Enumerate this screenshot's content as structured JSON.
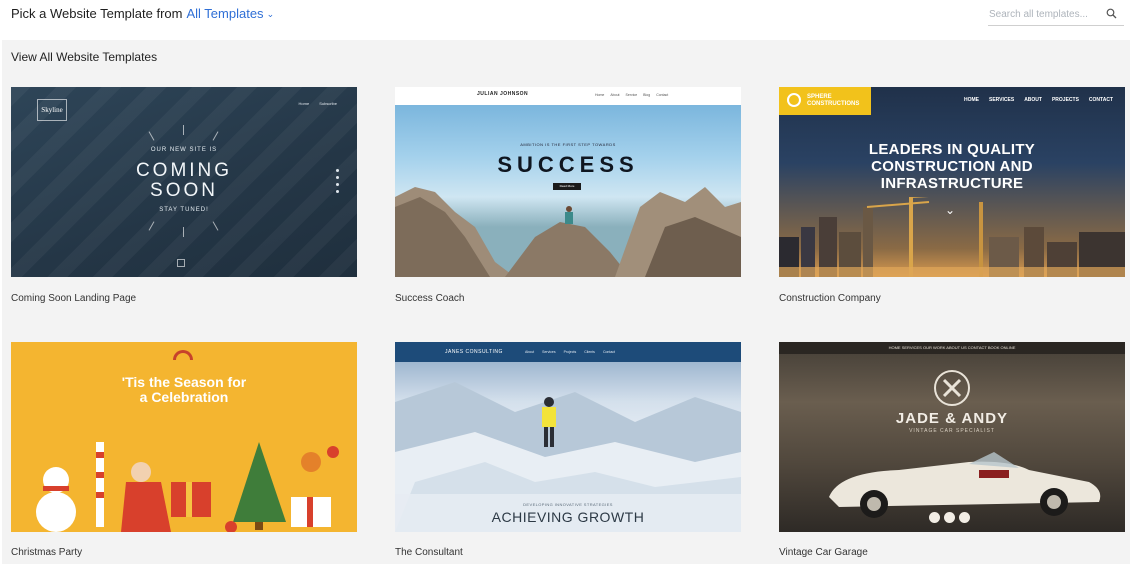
{
  "header": {
    "title_prefix": "Pick a Website Template from",
    "dropdown_label": "All Templates",
    "search_placeholder": "Search all templates..."
  },
  "gallery": {
    "heading": "View All Website Templates",
    "templates": [
      {
        "label": "Coming Soon Landing Page",
        "thumb": {
          "logo": "Skyline",
          "kicker": "OUR NEW SITE IS",
          "line1": "COMING",
          "line2": "SOON",
          "tag": "STAY TUNED!"
        }
      },
      {
        "label": "Success Coach",
        "thumb": {
          "brand": "JULIAN JOHNSON",
          "kicker": "AMBITION IS THE FIRST STEP TOWARDS",
          "headline": "SUCCESS",
          "button": "Read More"
        }
      },
      {
        "label": "Construction Company",
        "thumb": {
          "logo_line1": "SPHERE",
          "logo_line2": "CONSTRUCTIONS",
          "nav": [
            "HOME",
            "SERVICES",
            "ABOUT",
            "PROJECTS",
            "CONTACT"
          ],
          "line1": "LEADERS IN QUALITY",
          "line2": "CONSTRUCTION AND",
          "line3": "INFRASTRUCTURE"
        }
      },
      {
        "label": "Christmas Party",
        "thumb": {
          "line1": "'Tis the Season for",
          "line2": "a Celebration"
        }
      },
      {
        "label": "The Consultant",
        "thumb": {
          "brand": "JANES CONSULTING",
          "kicker": "DEVELOPING INNOVATIVE STRATEGIES",
          "headline": "ACHIEVING GROWTH"
        }
      },
      {
        "label": "Vintage Car Garage",
        "thumb": {
          "nav": "HOME   SERVICES   OUR WORK   ABOUT US   CONTACT   BOOK ONLINE",
          "headline": "JADE & ANDY",
          "sub": "VINTAGE CAR SPECIALIST"
        }
      }
    ]
  },
  "colors": {
    "link_blue": "#2f6fd6",
    "gallery_bg": "#f3f3f3",
    "construction_yellow": "#f2c21b",
    "christmas_orange": "#f4b530",
    "consultant_navy": "#1d4b79"
  },
  "icons": [
    "chevron-down-icon",
    "search-icon",
    "down-chevron-icon"
  ]
}
